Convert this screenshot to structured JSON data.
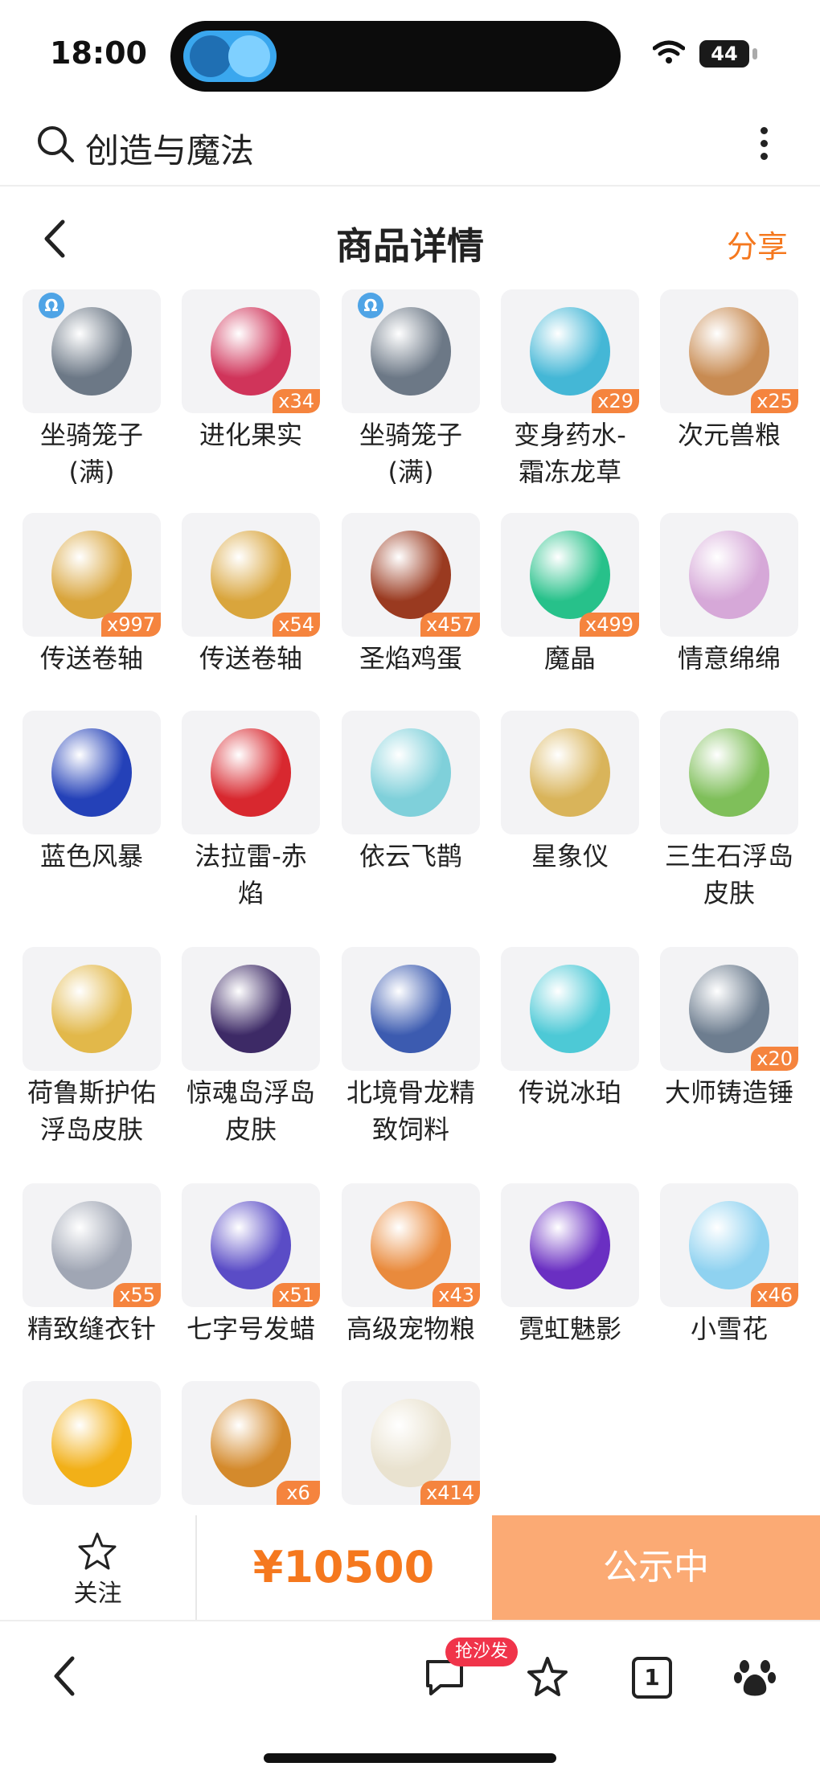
{
  "status_bar": {
    "time": "18:00",
    "battery": "44"
  },
  "search": {
    "query": "创造与魔法"
  },
  "header": {
    "title": "商品详情",
    "share": "分享"
  },
  "items": [
    {
      "name": "坐骑笼子\n(满)",
      "qty": "",
      "icon": "mount-cage-icon",
      "color": "#6c7886"
    },
    {
      "name": "进化果实",
      "qty": "x34",
      "icon": "evolution-fruit-icon",
      "color": "#d0345a"
    },
    {
      "name": "坐骑笼子\n(满)",
      "qty": "",
      "icon": "mount-cage-icon",
      "color": "#6c7886"
    },
    {
      "name": "变身药水-\n霜冻龙草",
      "qty": "x29",
      "icon": "potion-icon",
      "color": "#44b7d6"
    },
    {
      "name": "次元兽粮",
      "qty": "x25",
      "icon": "feed-bag-icon",
      "color": "#c88b52"
    },
    {
      "name": "传送卷轴",
      "qty": "x997",
      "icon": "scroll-icon",
      "color": "#d9a53c"
    },
    {
      "name": "传送卷轴",
      "qty": "x54",
      "icon": "scroll-icon",
      "color": "#d9a53c"
    },
    {
      "name": "圣焰鸡蛋",
      "qty": "x457",
      "icon": "egg-icon",
      "color": "#9a3a20"
    },
    {
      "name": "魔晶",
      "qty": "x499",
      "icon": "magic-crystal-icon",
      "color": "#27c18a"
    },
    {
      "name": "情意绵绵",
      "qty": "",
      "icon": "wreath-icon",
      "color": "#d6a8d8"
    },
    {
      "name": "蓝色风暴",
      "qty": "",
      "icon": "blue-car-icon",
      "color": "#2441b8"
    },
    {
      "name": "法拉雷-赤\n焰",
      "qty": "",
      "icon": "red-car-icon",
      "color": "#d8282f"
    },
    {
      "name": "依云飞鹊",
      "qty": "",
      "icon": "drone-icon",
      "color": "#7fd0da"
    },
    {
      "name": "星象仪",
      "qty": "",
      "icon": "astrolabe-icon",
      "color": "#d9b45a"
    },
    {
      "name": "三生石浮岛\n皮肤",
      "qty": "",
      "icon": "floating-island-icon",
      "color": "#7fbf5a"
    },
    {
      "name": "荷鲁斯护佑\n浮岛皮肤",
      "qty": "",
      "icon": "horus-island-icon",
      "color": "#e2b84a"
    },
    {
      "name": "惊魂岛浮岛\n皮肤",
      "qty": "",
      "icon": "dark-island-icon",
      "color": "#3d2a66"
    },
    {
      "name": "北境骨龙精\n致饲料",
      "qty": "",
      "icon": "gift-feed-icon",
      "color": "#3c5bb0"
    },
    {
      "name": "传说冰珀",
      "qty": "",
      "icon": "ice-spear-icon",
      "color": "#4dc9d6"
    },
    {
      "name": "大师铸造锤",
      "qty": "x20",
      "icon": "hammer-icon",
      "color": "#6d7d8f"
    },
    {
      "name": "精致缝衣针",
      "qty": "x55",
      "icon": "needle-icon",
      "color": "#a0a6b4"
    },
    {
      "name": "七字号发蜡",
      "qty": "x51",
      "icon": "hair-wax-icon",
      "color": "#5a4cc6"
    },
    {
      "name": "高级宠物粮",
      "qty": "x43",
      "icon": "pet-food-icon",
      "color": "#e98a3c"
    },
    {
      "name": "霓虹魅影",
      "qty": "",
      "icon": "neon-car-icon",
      "color": "#6a2fc2"
    },
    {
      "name": "小雪花",
      "qty": "x46",
      "icon": "snowflake-icon",
      "color": "#8fd2f0"
    },
    {
      "name": "",
      "qty": "",
      "icon": "gold-coin-icon",
      "color": "#f2b018"
    },
    {
      "name": "",
      "qty": "x6",
      "icon": "golden-key-icon",
      "color": "#d48a2c"
    },
    {
      "name": "",
      "qty": "x414",
      "icon": "pyramid-icon",
      "color": "#e9e2cf"
    }
  ],
  "action_bar": {
    "follow": "关注",
    "price": "¥10500",
    "cta": "公示中"
  },
  "toolbar": {
    "sofa_badge": "抢沙发",
    "tabs_count": "1"
  },
  "colors": {
    "accent": "#f5781e",
    "cta_bg": "#fbaa74",
    "qty_badge": "#f5843e",
    "sofa_badge": "#f0344a"
  }
}
